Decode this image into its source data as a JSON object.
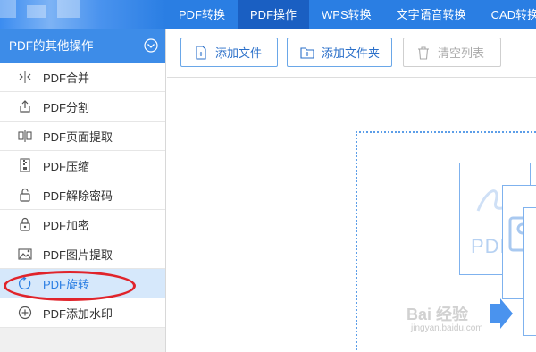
{
  "topbar": {
    "tabs": [
      {
        "label": "PDF转换"
      },
      {
        "label": "PDF操作"
      },
      {
        "label": "WPS转换"
      },
      {
        "label": "文字语音转换"
      },
      {
        "label": "CAD转换"
      }
    ],
    "active_tab": "PDF操作"
  },
  "sidebar": {
    "header": "PDF的其他操作",
    "items": [
      {
        "label": "PDF合并",
        "icon": "merge-icon"
      },
      {
        "label": "PDF分割",
        "icon": "split-icon"
      },
      {
        "label": "PDF页面提取",
        "icon": "page-extract-icon"
      },
      {
        "label": "PDF压缩",
        "icon": "compress-icon"
      },
      {
        "label": "PDF解除密码",
        "icon": "unlock-icon"
      },
      {
        "label": "PDF加密",
        "icon": "lock-icon"
      },
      {
        "label": "PDF图片提取",
        "icon": "image-extract-icon"
      },
      {
        "label": "PDF旋转",
        "icon": "rotate-icon"
      },
      {
        "label": "PDF添加水印",
        "icon": "watermark-icon"
      }
    ],
    "selected": "PDF旋转"
  },
  "toolbar": {
    "add_file": "添加文件",
    "add_folder": "添加文件夹",
    "clear_list": "清空列表"
  },
  "dropzone": {
    "doc_label": "PDF"
  },
  "watermark": {
    "text": "Bai 经验",
    "sub": "jingyan.baidu.com"
  },
  "colors": {
    "brand": "#2a7ee3",
    "active_tab": "#1a5fc2",
    "annotation": "#e0242b"
  }
}
